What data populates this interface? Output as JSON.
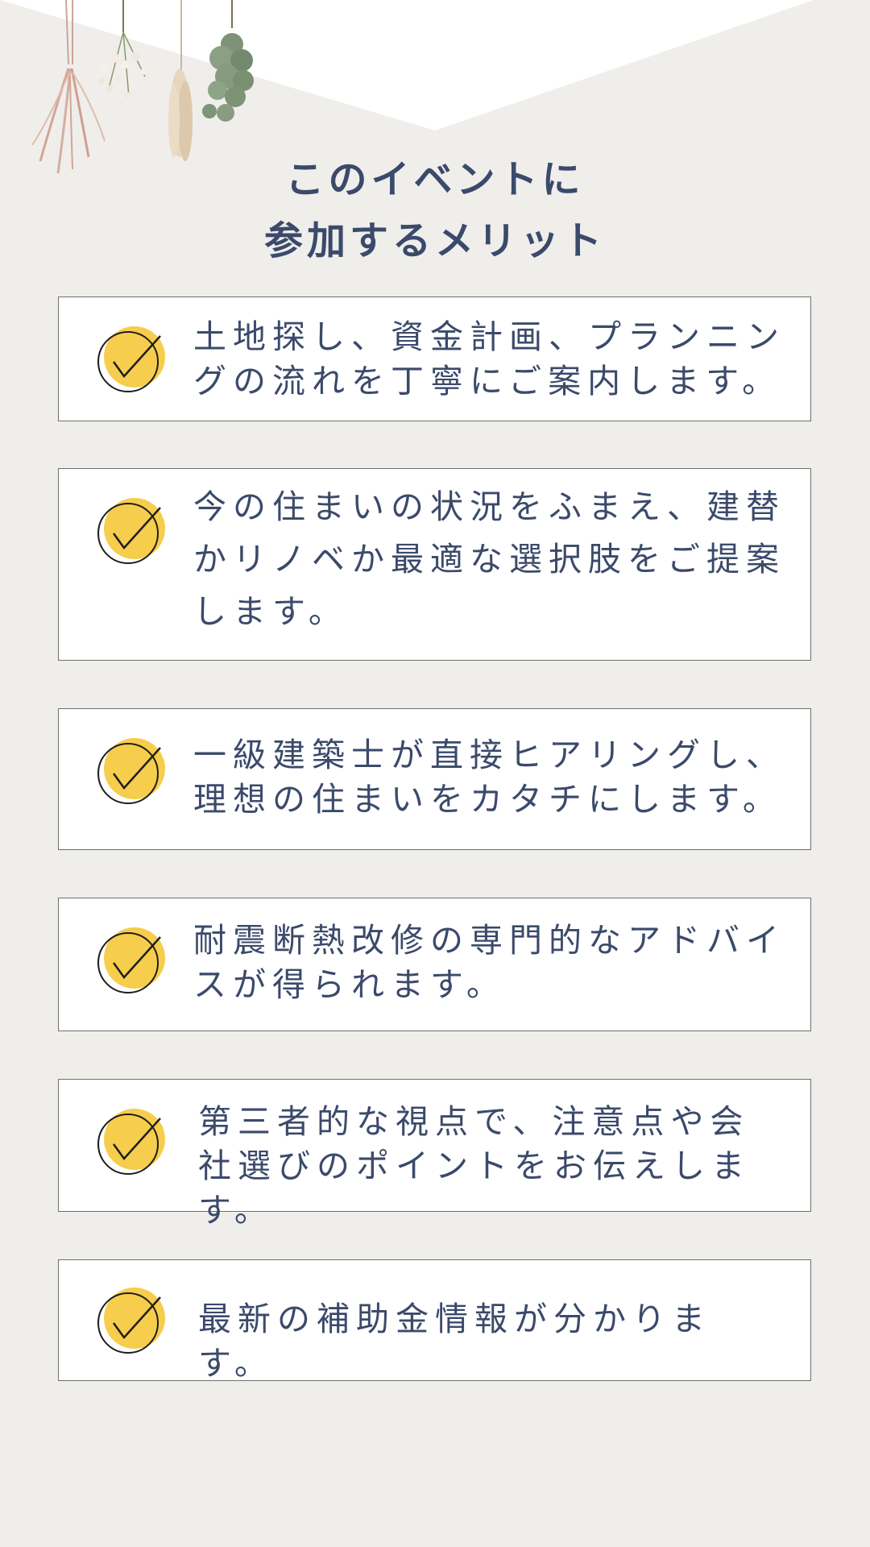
{
  "heading": {
    "line1": "このイベントに",
    "line2": "参加するメリット"
  },
  "benefits": [
    {
      "text": "土地探し、資金計画、プランニングの流れを丁寧にご案内します。"
    },
    {
      "text": "今の住まいの状況をふまえ、建替かリノベか最適な選択肢をご提案します。"
    },
    {
      "text": "一級建築士が直接ヒアリングし、理想の住まいをカタチにします。"
    },
    {
      "text": "耐震断熱改修の専門的なアドバイスが得られます。"
    },
    {
      "text": "第三者的な視点で、注意点や会社選びのポイントをお伝えします。"
    },
    {
      "text": "最新の補助金情報が分かります。"
    }
  ],
  "colors": {
    "background": "#efeeeb",
    "text": "#3b4a6b",
    "check_accent": "#f6cd4c",
    "card_border": "#6f6f6f"
  },
  "icons": {
    "check": "checkmark-circle-icon",
    "decoration": "dried-flowers-illustration"
  }
}
